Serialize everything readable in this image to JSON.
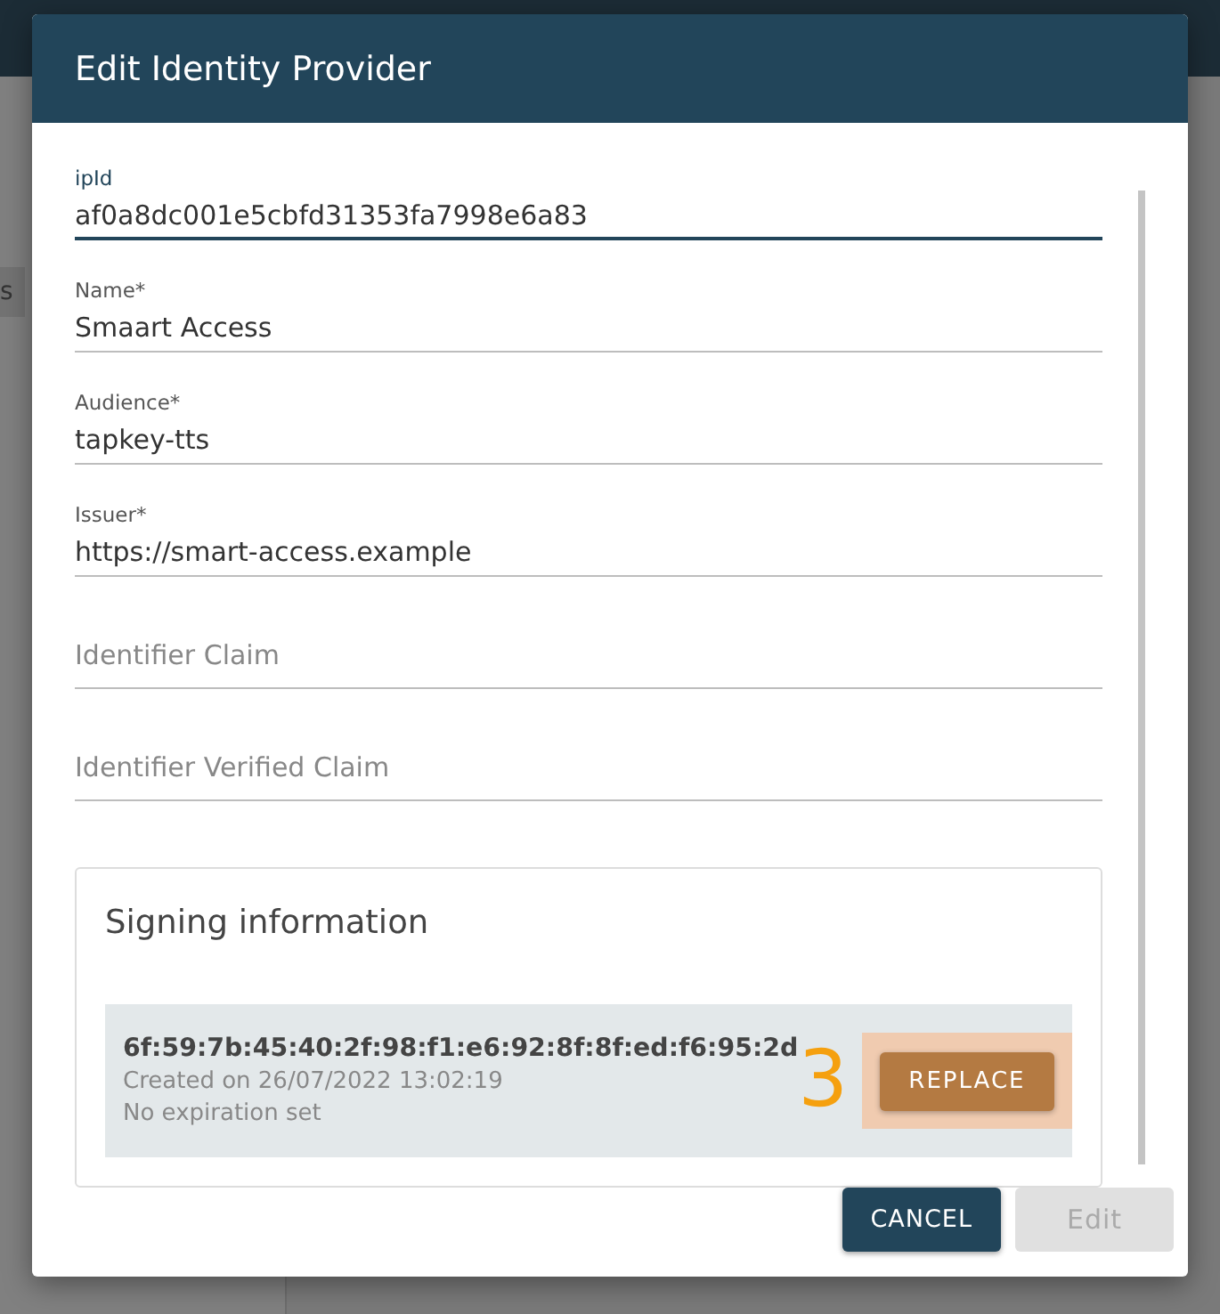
{
  "background": {
    "sidebar_item": "s"
  },
  "dialog": {
    "title": "Edit Identity Provider",
    "fields": [
      {
        "label": "ipId",
        "value": "af0a8dc001e5cbfd31353fa7998e6a83",
        "focused": true
      },
      {
        "label": "Name*",
        "value": "Smaart Access",
        "focused": false
      },
      {
        "label": "Audience*",
        "value": "tapkey-tts",
        "focused": false
      },
      {
        "label": "Issuer*",
        "value": "https://smart-access.example",
        "focused": false
      },
      {
        "label": "Identifier Claim",
        "focused": false
      },
      {
        "label": "Identifier Verified Claim",
        "focused": false
      }
    ],
    "signing": {
      "title": "Signing information",
      "fingerprint": "6f:59:7b:45:40:2f:98:f1:e6:92:8f:8f:ed:f6:95:2d",
      "created": "Created on 26/07/2022 13:02:19",
      "expiration": "No expiration set",
      "button": "REPLACE",
      "annotation": "3"
    },
    "buttons": [
      {
        "label": "CANCEL",
        "disabled": false
      },
      {
        "label": "Edit",
        "disabled": true
      }
    ]
  }
}
